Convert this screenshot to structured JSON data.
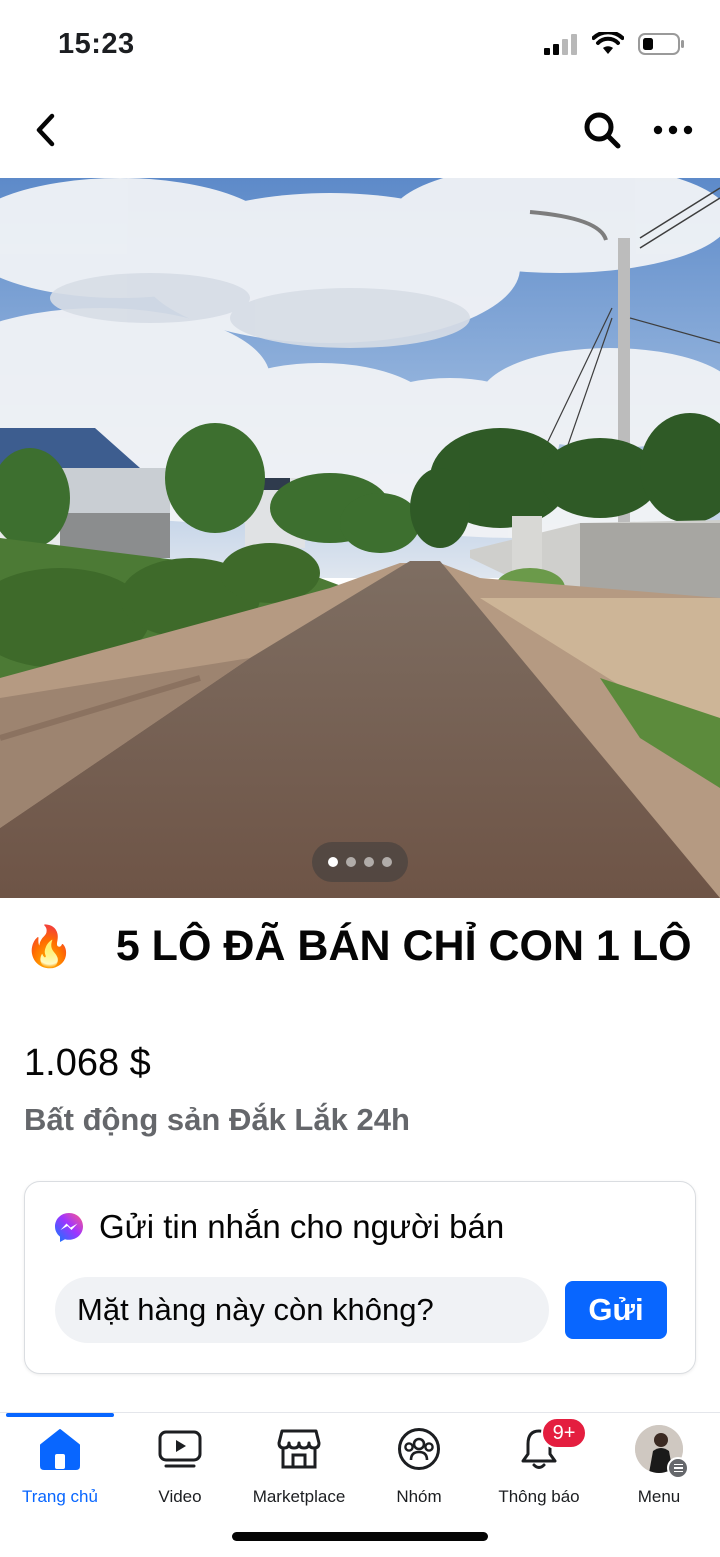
{
  "status_bar": {
    "time": "15:23",
    "icons": [
      "cellular-signal-icon",
      "wifi-icon",
      "battery-icon"
    ]
  },
  "top_nav": {
    "icons": [
      "chevron-left-icon",
      "search-icon",
      "more-icon"
    ]
  },
  "photo": {
    "description_icon": "listing-photo",
    "carousel": {
      "count": 4,
      "active_index": 0
    }
  },
  "listing": {
    "emoji": "🔥",
    "title": "5 LÔ ĐÃ BÁN CHỈ CON 1 LÔ",
    "price": "1.068 $",
    "location": "Bất động sản Đắk Lắk 24h"
  },
  "message_card": {
    "icon": "messenger-icon",
    "title": "Gửi tin nhắn cho người bán",
    "input_value": "Mặt hàng này còn không?",
    "send_label": "Gửi"
  },
  "tab_bar": {
    "tabs": [
      {
        "label": "Trang chủ",
        "icon": "home-icon",
        "active": true
      },
      {
        "label": "Video",
        "icon": "video-icon",
        "active": false
      },
      {
        "label": "Marketplace",
        "icon": "marketplace-icon",
        "active": false
      },
      {
        "label": "Nhóm",
        "icon": "groups-icon",
        "active": false
      },
      {
        "label": "Thông báo",
        "icon": "bell-icon",
        "active": false,
        "badge": "9+"
      },
      {
        "label": "Menu",
        "icon": "avatar",
        "active": false
      }
    ]
  },
  "colors": {
    "accent": "#0866ff",
    "badge": "#e41e3f",
    "secondary_text": "#65676b",
    "input_bg": "#f0f2f5"
  }
}
